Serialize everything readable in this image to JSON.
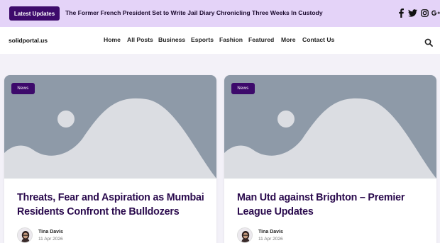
{
  "topbar": {
    "badge_label": "Latest Updates",
    "headline": "The Former French President Set to Write Jail Diary Chronicling Three Weeks In Custody",
    "social_icons": [
      "facebook-icon",
      "twitter-icon",
      "instagram-icon",
      "google-plus-icon"
    ]
  },
  "nav": {
    "logo": "solidportal.us",
    "items": [
      "Home",
      "All Posts",
      "Business",
      "Esports",
      "Fashion",
      "Featured",
      "More",
      "Contact Us"
    ],
    "search_icon": "search-icon"
  },
  "cards": [
    {
      "category": "News",
      "title": "Threats, Fear and Aspiration as Mumbai Residents Confront the Bulldozers",
      "author": "Tina Davis",
      "date": "11 Apr 2026"
    },
    {
      "category": "News",
      "title": "Man Utd against Brighton – Premier League Updates",
      "author": "Tina Davis",
      "date": "11 Apr 2026"
    }
  ],
  "colors": {
    "topbar_bg": "#e4d3f8",
    "accent": "#3d0a6b",
    "title_color": "#2a0a4d"
  }
}
